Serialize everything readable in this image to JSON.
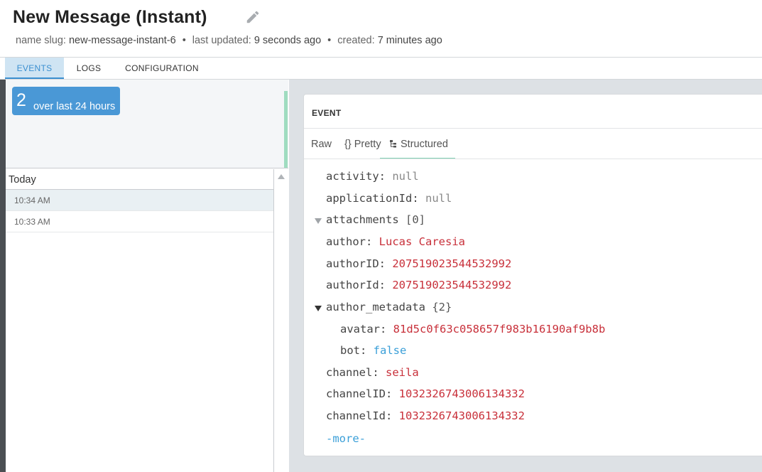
{
  "header": {
    "title": "New Message (Instant)",
    "name_slug_label": "name slug:",
    "name_slug": "new-message-instant-6",
    "last_updated_label": "last updated:",
    "last_updated": "9 seconds ago",
    "created_label": "created:",
    "created": "7 minutes ago",
    "separator": "•"
  },
  "tabs": {
    "events": "EVENTS",
    "logs": "LOGS",
    "configuration": "CONFIGURATION"
  },
  "stats": {
    "count": "2",
    "period": "over last 24 hours"
  },
  "event_list": {
    "group": "Today",
    "items": [
      "10:34 AM",
      "10:33 AM"
    ]
  },
  "event": {
    "title": "EVENT",
    "views": {
      "raw": "Raw",
      "pretty": "{} Pretty",
      "structured": "Structured"
    },
    "fields": {
      "activity": {
        "key": "activity:",
        "value": "null"
      },
      "applicationId": {
        "key": "applicationId:",
        "value": "null"
      },
      "attachments": {
        "key": "attachments",
        "meta": "[0]"
      },
      "author": {
        "key": "author:",
        "value": "Lucas Caresia"
      },
      "authorID": {
        "key": "authorID:",
        "value": "207519023544532992"
      },
      "authorId": {
        "key": "authorId:",
        "value": "207519023544532992"
      },
      "author_metadata": {
        "key": "author_metadata",
        "meta": "{2}"
      },
      "avatar": {
        "key": "avatar:",
        "value": "81d5c0f63c058657f983b16190af9b8b"
      },
      "bot": {
        "key": "bot:",
        "value": "false"
      },
      "channel": {
        "key": "channel:",
        "value": "seila"
      },
      "channelID": {
        "key": "channelID:",
        "value": "1032326743006134332"
      },
      "channelId": {
        "key": "channelId:",
        "value": "1032326743006134332"
      }
    },
    "more": "-more-"
  },
  "colors": {
    "accent": "#3b8fd0",
    "badge": "#4a98d6",
    "string_value": "#c8303a",
    "bool_value": "#3a9fd8",
    "null_value": "#888888"
  },
  "icons": {
    "edit": "pencil-icon",
    "structured": "tree-icon",
    "scroll_up": "triangle-up-icon",
    "collapsed": "triangle-down-icon",
    "expanded": "triangle-down-icon"
  }
}
